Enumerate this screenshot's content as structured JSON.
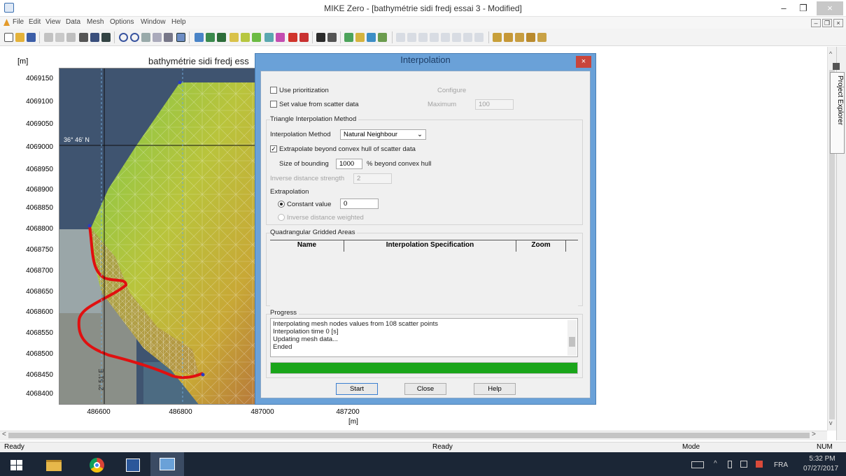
{
  "window": {
    "title": "MIKE Zero - [bathymétrie sidi fredj essai 3 - Modified]"
  },
  "menu": [
    "File",
    "Edit",
    "View",
    "Data",
    "Mesh",
    "Options",
    "Window",
    "Help"
  ],
  "plot": {
    "title": "bathymétrie sidi fredj ess",
    "y_unit": "[m]",
    "x_unit": "[m]",
    "y_ticks": [
      "4069150",
      "4069100",
      "4069050",
      "4069000",
      "4068950",
      "4068900",
      "4068850",
      "4068800",
      "4068750",
      "4068700",
      "4068650",
      "4068600",
      "4068550",
      "4068500",
      "4068450",
      "4068400"
    ],
    "x_ticks": [
      "486600",
      "486800",
      "487000",
      "487200"
    ],
    "lat_label": "36° 46' N",
    "lon_label": "2° 51' E"
  },
  "dialog": {
    "title": "Interpolation",
    "close_glyph": "×",
    "use_prioritization": "Use prioritization",
    "configure": "Configure",
    "set_value": "Set value from scatter data",
    "maximum_label": "Maximum",
    "maximum_value": "100",
    "triangle_group": "Triangle Interpolation Method",
    "method_label": "Interpolation Method",
    "method_value": "Natural Neighbour",
    "extrapolate_label": "Extrapolate beyond convex hull of scatter data",
    "bounding_label": "Size of bounding",
    "bounding_value": "1000",
    "bounding_suffix": "% beyond convex hull",
    "inverse_strength_label": "Inverse distance strength",
    "inverse_strength_value": "2",
    "extrapolation_group": "Extrapolation",
    "constant_label": "Constant value",
    "constant_value": "0",
    "inverse_weighted_label": "Inverse distance weighted",
    "quad_group": "Quadrangular Gridded Areas",
    "columns": [
      "Name",
      "Interpolation Specification",
      "Zoom"
    ],
    "progress_group": "Progress",
    "progress_lines": [
      "Interpolating mesh nodes values from 108 scatter points",
      "Interpolation time 0 [s]",
      "Updating mesh data...",
      "Ended"
    ],
    "progress_fraction": 1.0,
    "start": "Start",
    "close": "Close",
    "help": "Help"
  },
  "explorer": {
    "label": "Project Explorer"
  },
  "status": {
    "left": "Ready",
    "center": "Ready",
    "mode": "Mode",
    "num": "NUM"
  },
  "tray": {
    "lang": "FRA",
    "time": "5:32 PM",
    "date": "07/27/2017"
  },
  "colors": {
    "accent": "#6aa1d8",
    "progress": "#1aa51a",
    "boundary": "#e01010"
  }
}
